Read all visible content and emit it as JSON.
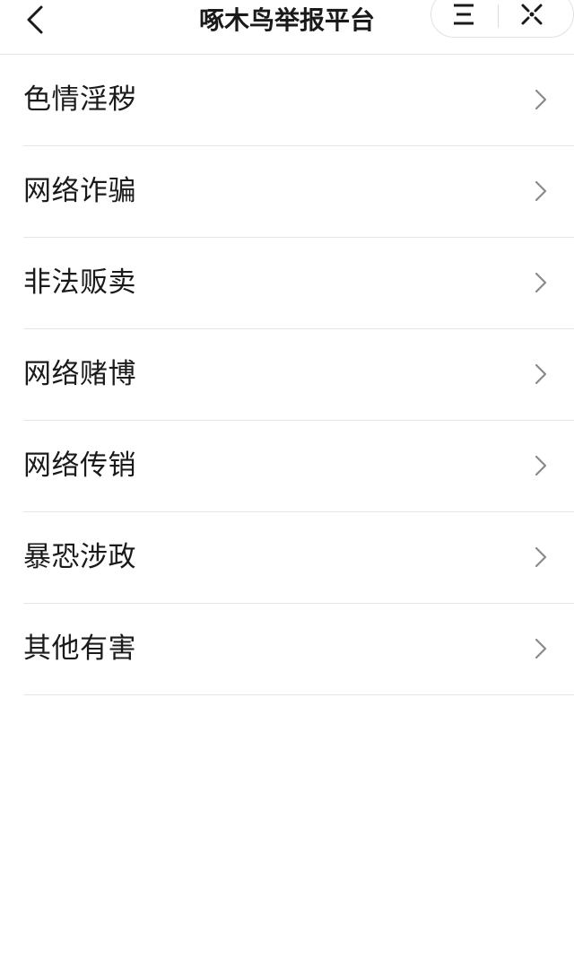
{
  "header": {
    "title": "啄木鸟举报平台",
    "back_icon": "chevron-left-icon",
    "menu_icon": "menu-lines-icon",
    "close_icon": "close-icon"
  },
  "report_categories": [
    {
      "label": "色情淫秽",
      "icon": "chevron-right-icon"
    },
    {
      "label": "网络诈骗",
      "icon": "chevron-right-icon"
    },
    {
      "label": "非法贩卖",
      "icon": "chevron-right-icon"
    },
    {
      "label": "网络赌博",
      "icon": "chevron-right-icon"
    },
    {
      "label": "网络传销",
      "icon": "chevron-right-icon"
    },
    {
      "label": "暴恐涉政",
      "icon": "chevron-right-icon"
    },
    {
      "label": "其他有害",
      "icon": "chevron-right-icon"
    }
  ],
  "colors": {
    "text": "#1a1a1a",
    "divider": "#e6e6e6",
    "chevron": "#8a8a8a",
    "background": "#ffffff"
  }
}
